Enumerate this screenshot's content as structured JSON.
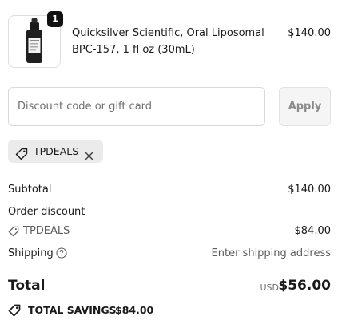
{
  "order_summary": {
    "product": {
      "name": "Quicksilver Scientific, Oral Liposomal BPC-157, 1 fl oz (30mL)",
      "price": "$140.00",
      "quantity": "1"
    },
    "discount": {
      "placeholder": "Discount code or gift card",
      "apply_label": "Apply",
      "applied_code": "TPDEALS"
    },
    "subtotal": {
      "label": "Subtotal",
      "value": "$140.00"
    },
    "order_discount": {
      "label": "Order discount",
      "code": "TPDEALS",
      "value": "– $84.00"
    },
    "shipping": {
      "label": "Shipping",
      "value": "Enter shipping address"
    },
    "total": {
      "label": "Total",
      "currency": "USD",
      "value": "$56.00"
    },
    "savings": {
      "label": "TOTAL SAVINGS",
      "value": "$84.00"
    }
  }
}
